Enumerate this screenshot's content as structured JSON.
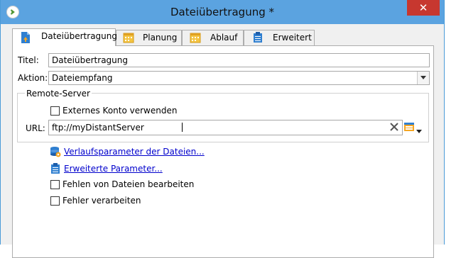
{
  "window": {
    "title": "Dateiübertragung *",
    "close_glyph": "✕"
  },
  "tabs": [
    {
      "label": "Dateiübertragung",
      "icon": "file-transfer-icon",
      "active": true
    },
    {
      "label": "Planung",
      "icon": "calendar-icon",
      "active": false
    },
    {
      "label": "Ablauf",
      "icon": "calendar-icon",
      "active": false
    },
    {
      "label": "Erweitert",
      "icon": "clipboard-icon",
      "active": false
    }
  ],
  "form": {
    "title_label": "Titel:",
    "title_value": "Dateiübertragung",
    "action_label": "Aktion:",
    "action_value": "Dateiempfang"
  },
  "remote_server": {
    "group_label": "Remote-Server",
    "external_account_label": "Externes Konto verwenden",
    "external_account_checked": false,
    "url_label": "URL:",
    "url_value": "ftp://myDistantServer"
  },
  "links": {
    "history_params": "Verlaufsparameter der Dateien...",
    "advanced_params": "Erweiterte Parameter..."
  },
  "options": {
    "handle_missing_files": "Fehlen von Dateien bearbeiten",
    "handle_missing_checked": false,
    "process_errors": "Fehler verarbeiten",
    "process_errors_checked": false
  },
  "colors": {
    "titlebar": "#5ba3e0",
    "close": "#c7372f",
    "link": "#0000cc",
    "accent_orange": "#f5a623",
    "accent_blue": "#2f7fd0"
  }
}
